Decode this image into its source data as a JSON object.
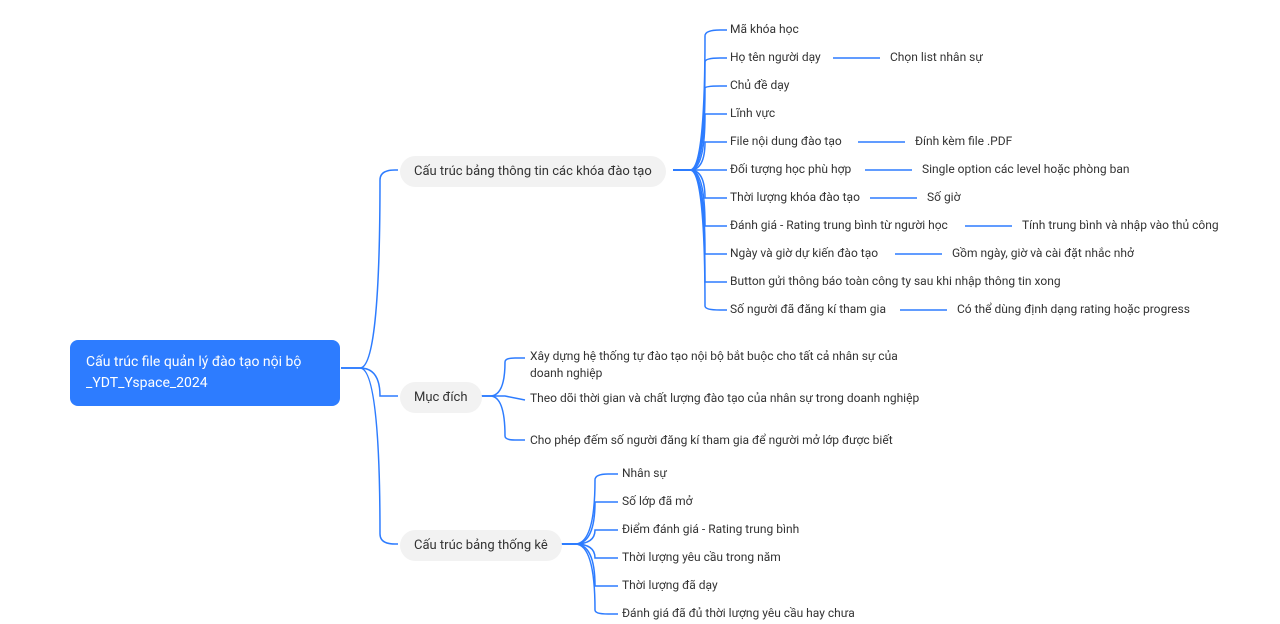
{
  "root": {
    "line1": "Cấu trúc file quản lý đào tạo nội bộ",
    "line2": "_YDT_Yspace_2024"
  },
  "branch1": {
    "label": "Cấu trúc bảng thông tin các khóa đào tạo",
    "items": {
      "c1": "Mã khóa học",
      "c2": "Họ tên người dạy",
      "c2s": "Chọn list nhân sự",
      "c3": "Chủ đề dạy",
      "c4": "Lĩnh vực",
      "c5": "File nội dung đào tạo",
      "c5s": "Đính kèm file .PDF",
      "c6": "Đối tượng học phù hợp",
      "c6s": "Single option các level hoặc phòng ban",
      "c7": "Thời lượng khóa đào tạo",
      "c7s": "Số giờ",
      "c8": "Đánh giá - Rating trung bình từ người học",
      "c8s": "Tính trung bình và nhập vào thủ công",
      "c9": "Ngày và giờ dự kiến đào tạo",
      "c9s": "Gồm ngày, giờ và cài đặt nhắc nhở",
      "c10": "Button gửi thông báo toàn công ty sau khi nhập thông tin xong",
      "c11": "Số người đã đăng kí tham gia",
      "c11s": "Có thể dùng định dạng rating hoặc progress"
    }
  },
  "branch2": {
    "label": "Mục đích",
    "items": {
      "m1": "Xây dựng hệ thống tự đào tạo nội bộ bắt buộc cho tất cả nhân sự của doanh nghiệp",
      "m2": "Theo dõi thời gian và chất lượng đào tạo của nhân sự trong doanh nghiệp",
      "m3": "Cho phép đếm số người đăng kí tham gia để người mở lớp được biết"
    }
  },
  "branch3": {
    "label": "Cấu trúc bảng thống kê",
    "items": {
      "t1": "Nhân sự",
      "t2": "Số lớp đã mở",
      "t3": "Điểm đánh giá - Rating trung bình",
      "t4": "Thời lượng yêu cầu trong năm",
      "t5": "Thời lượng đã dạy",
      "t6": "Đánh giá đã đủ thời lượng yêu cầu hay chưa"
    }
  }
}
